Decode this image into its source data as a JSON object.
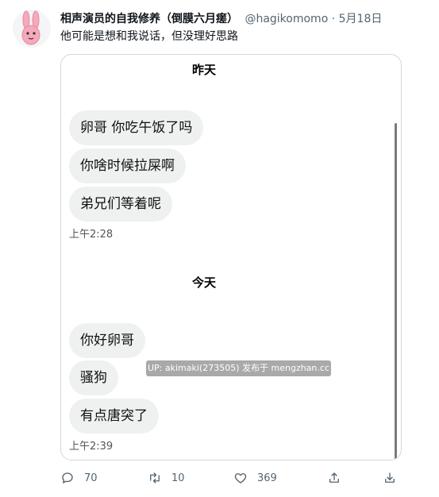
{
  "tweet": {
    "display_name": "相声演员的自我修养（倒膜六月瘥）",
    "handle": "@hagikomomo",
    "separator": "·",
    "date": "5月18日",
    "text": "他可能是想和我说话，但没理好思路"
  },
  "chat": {
    "day1_label": "昨天",
    "day1_messages": [
      "卵哥 你吃午饭了吗",
      "你啥时候拉屎啊",
      "弟兄们等着呢"
    ],
    "day1_time": "上午2:28",
    "day2_label": "今天",
    "day2_messages": [
      "你好卵哥",
      "骚狗",
      "有点唐突了"
    ],
    "day2_time": "上午2:39",
    "watermark": "UP: akimaki(273505) 发布于 mengzhan.cc"
  },
  "actions": {
    "reply_count": "70",
    "retweet_count": "10",
    "like_count": "369"
  },
  "icons": {
    "avatar": "pink-rabbit-avatar",
    "reply": "reply-icon",
    "retweet": "retweet-icon",
    "like": "heart-icon",
    "share": "share-icon",
    "download": "download-icon"
  },
  "colors": {
    "text": "#0f1419",
    "secondary": "#536471",
    "bubble": "#eef1f0",
    "border": "#cfd9de"
  }
}
